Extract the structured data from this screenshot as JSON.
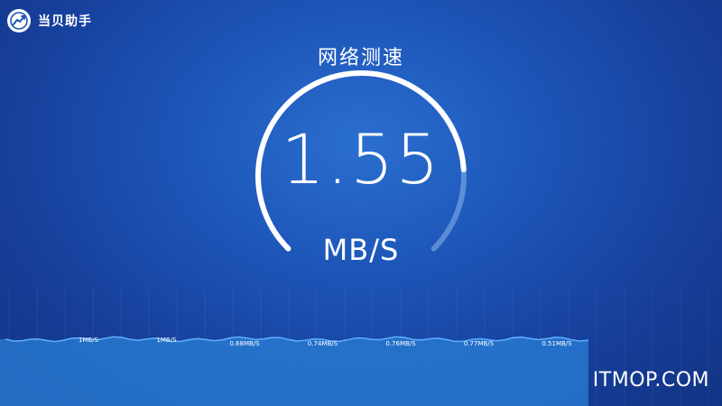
{
  "header": {
    "app_name": "当贝助手",
    "logo_icon": "speedometer-icon"
  },
  "title": "网络测速",
  "speed": {
    "value": "1.55",
    "unit": "MB/S",
    "gauge_fraction": 0.82
  },
  "history": {
    "labels": [
      "1MB/S",
      "1MB/S",
      "0.68MB/S",
      "0.74MB/S",
      "0.76MB/S",
      "0.77MB/S",
      "0.51MB/S"
    ]
  },
  "watermark": "ITMOP.COM",
  "colors": {
    "accent": "#ffffff",
    "background": "#1d55b8",
    "chart_fill": "#2a7fd6",
    "chart_line": "#5fb0ff",
    "gauge_track": "#8fb7ec"
  }
}
